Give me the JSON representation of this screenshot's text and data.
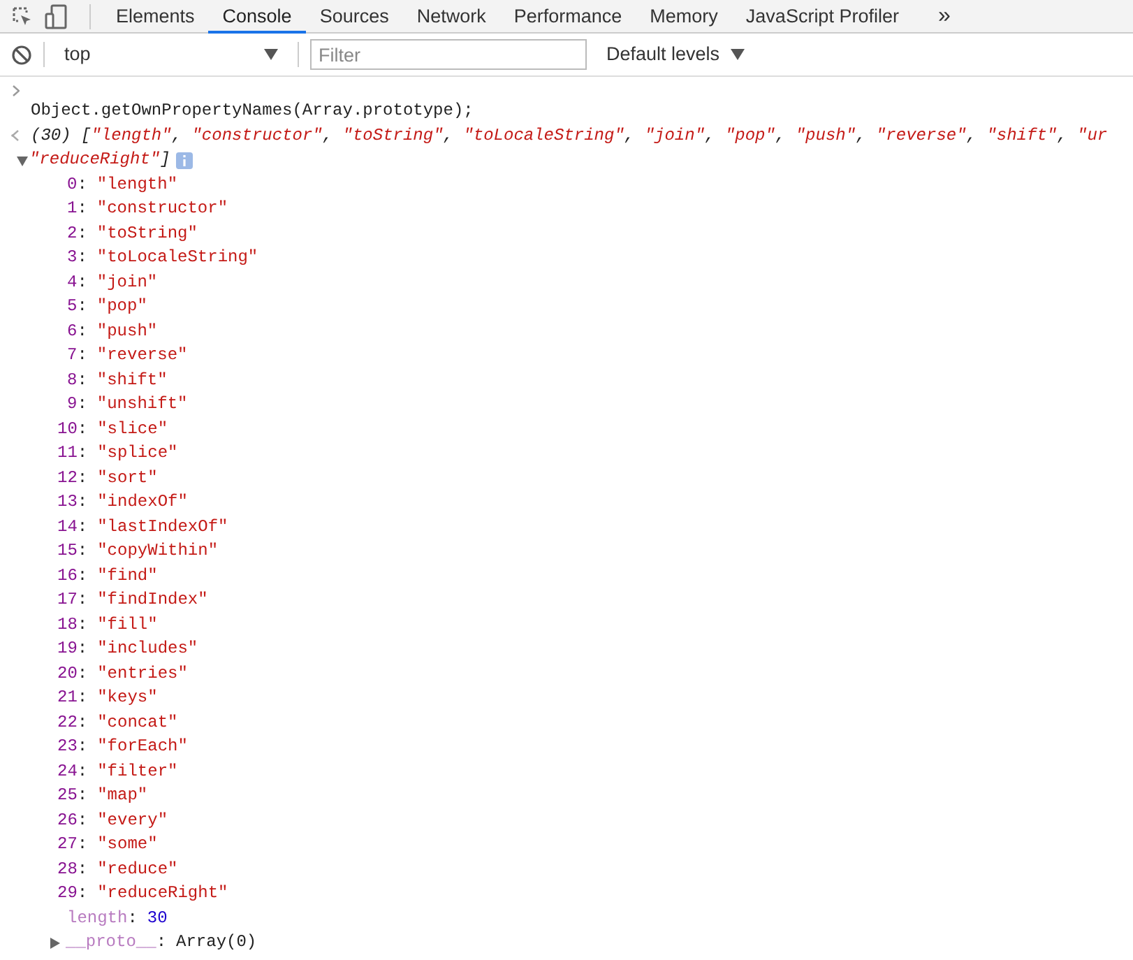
{
  "toolbar": {
    "tabs": [
      {
        "label": "Elements",
        "selected": false
      },
      {
        "label": "Console",
        "selected": true
      },
      {
        "label": "Sources",
        "selected": false
      },
      {
        "label": "Network",
        "selected": false
      },
      {
        "label": "Performance",
        "selected": false
      },
      {
        "label": "Memory",
        "selected": false
      },
      {
        "label": "JavaScript Profiler",
        "selected": false
      }
    ],
    "overflow": "»"
  },
  "console_bar": {
    "context": "top",
    "filter_placeholder": "Filter",
    "levels": "Default levels"
  },
  "input": "Object.getOwnPropertyNames(Array.prototype);",
  "result": {
    "expanded": true,
    "count": "(30)",
    "preview": [
      {
        "kind": "punct",
        "text": "["
      },
      {
        "kind": "str",
        "text": "\"length\""
      },
      {
        "kind": "punct",
        "text": ", "
      },
      {
        "kind": "str",
        "text": "\"constructor\""
      },
      {
        "kind": "punct",
        "text": ", "
      },
      {
        "kind": "str",
        "text": "\"toString\""
      },
      {
        "kind": "punct",
        "text": ", "
      },
      {
        "kind": "str",
        "text": "\"toLocaleString\""
      },
      {
        "kind": "punct",
        "text": ", "
      },
      {
        "kind": "str",
        "text": "\"join\""
      },
      {
        "kind": "punct",
        "text": ", "
      },
      {
        "kind": "str",
        "text": "\"pop\""
      },
      {
        "kind": "punct",
        "text": ", "
      },
      {
        "kind": "str",
        "text": "\"push\""
      },
      {
        "kind": "punct",
        "text": ", "
      },
      {
        "kind": "str",
        "text": "\"reverse\""
      },
      {
        "kind": "punct",
        "text": ", "
      },
      {
        "kind": "str",
        "text": "\"shift\""
      },
      {
        "kind": "punct",
        "text": ", "
      },
      {
        "kind": "str",
        "text": "\"ur"
      }
    ],
    "preview_tail": [
      {
        "kind": "str",
        "text": "\"reduceRight\""
      },
      {
        "kind": "punct",
        "text": "]"
      }
    ],
    "items": [
      {
        "index": "0",
        "colon": ":",
        "value": "\"length\""
      },
      {
        "index": "1",
        "colon": ":",
        "value": "\"constructor\""
      },
      {
        "index": "2",
        "colon": ":",
        "value": "\"toString\""
      },
      {
        "index": "3",
        "colon": ":",
        "value": "\"toLocaleString\""
      },
      {
        "index": "4",
        "colon": ":",
        "value": "\"join\""
      },
      {
        "index": "5",
        "colon": ":",
        "value": "\"pop\""
      },
      {
        "index": "6",
        "colon": ":",
        "value": "\"push\""
      },
      {
        "index": "7",
        "colon": ":",
        "value": "\"reverse\""
      },
      {
        "index": "8",
        "colon": ":",
        "value": "\"shift\""
      },
      {
        "index": "9",
        "colon": ":",
        "value": "\"unshift\""
      },
      {
        "index": "10",
        "colon": ":",
        "value": "\"slice\""
      },
      {
        "index": "11",
        "colon": ":",
        "value": "\"splice\""
      },
      {
        "index": "12",
        "colon": ":",
        "value": "\"sort\""
      },
      {
        "index": "13",
        "colon": ":",
        "value": "\"indexOf\""
      },
      {
        "index": "14",
        "colon": ":",
        "value": "\"lastIndexOf\""
      },
      {
        "index": "15",
        "colon": ":",
        "value": "\"copyWithin\""
      },
      {
        "index": "16",
        "colon": ":",
        "value": "\"find\""
      },
      {
        "index": "17",
        "colon": ":",
        "value": "\"findIndex\""
      },
      {
        "index": "18",
        "colon": ":",
        "value": "\"fill\""
      },
      {
        "index": "19",
        "colon": ":",
        "value": "\"includes\""
      },
      {
        "index": "20",
        "colon": ":",
        "value": "\"entries\""
      },
      {
        "index": "21",
        "colon": ":",
        "value": "\"keys\""
      },
      {
        "index": "22",
        "colon": ":",
        "value": "\"concat\""
      },
      {
        "index": "23",
        "colon": ":",
        "value": "\"forEach\""
      },
      {
        "index": "24",
        "colon": ":",
        "value": "\"filter\""
      },
      {
        "index": "25",
        "colon": ":",
        "value": "\"map\""
      },
      {
        "index": "26",
        "colon": ":",
        "value": "\"every\""
      },
      {
        "index": "27",
        "colon": ":",
        "value": "\"some\""
      },
      {
        "index": "28",
        "colon": ":",
        "value": "\"reduce\""
      },
      {
        "index": "29",
        "colon": ":",
        "value": "\"reduceRight\""
      }
    ],
    "length": {
      "key": "length",
      "colon": ":",
      "value": "30"
    },
    "proto": {
      "key": "__proto__",
      "colon": ":",
      "value": "Array(0)",
      "expanded": false
    }
  }
}
